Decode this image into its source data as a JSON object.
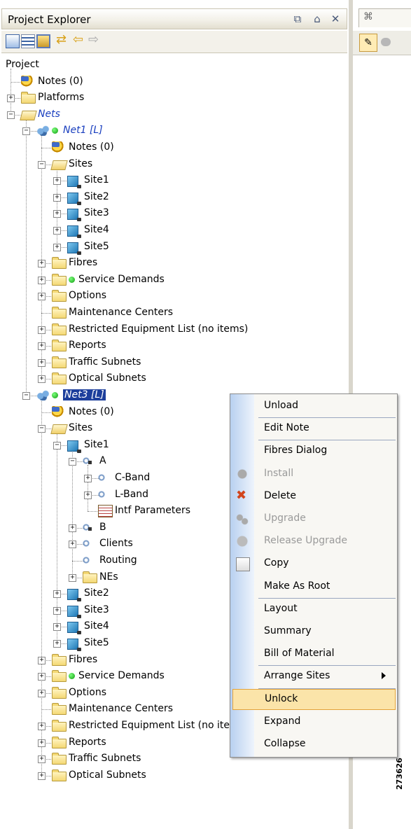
{
  "explorer": {
    "title": "Project Explorer",
    "window_buttons": [
      "⧉",
      "⌂",
      "✕"
    ]
  },
  "tree": [
    {
      "label": "Project",
      "icon": "none",
      "depth": 0,
      "expander": "none"
    },
    {
      "label": "Notes (0)",
      "icon": "notes",
      "depth": 1,
      "expander": "none"
    },
    {
      "label": "Platforms",
      "icon": "folder",
      "depth": 1,
      "expander": "+"
    },
    {
      "label": "Nets",
      "icon": "folder-open",
      "depth": 1,
      "expander": "-",
      "style": "italic-blue"
    },
    {
      "label": "Net1 [L]",
      "icon": "net",
      "depth": 2,
      "expander": "-",
      "style": "italic-blue",
      "status": "green"
    },
    {
      "label": "Notes (0)",
      "icon": "notes",
      "depth": 3,
      "expander": "none"
    },
    {
      "label": "Sites",
      "icon": "folder-open",
      "depth": 3,
      "expander": "-"
    },
    {
      "label": "Site1",
      "icon": "site",
      "depth": 4,
      "expander": "+"
    },
    {
      "label": "Site2",
      "icon": "site",
      "depth": 4,
      "expander": "+"
    },
    {
      "label": "Site3",
      "icon": "site",
      "depth": 4,
      "expander": "+"
    },
    {
      "label": "Site4",
      "icon": "site",
      "depth": 4,
      "expander": "+"
    },
    {
      "label": "Site5",
      "icon": "site",
      "depth": 4,
      "expander": "+"
    },
    {
      "label": "Fibres",
      "icon": "folder",
      "depth": 3,
      "expander": "+"
    },
    {
      "label": "Service Demands",
      "icon": "folder",
      "depth": 3,
      "expander": "+",
      "status": "green"
    },
    {
      "label": "Options",
      "icon": "folder",
      "depth": 3,
      "expander": "+"
    },
    {
      "label": "Maintenance Centers",
      "icon": "folder",
      "depth": 3,
      "expander": "none"
    },
    {
      "label": "Restricted Equipment List (no items)",
      "icon": "folder",
      "depth": 3,
      "expander": "+"
    },
    {
      "label": "Reports",
      "icon": "folder",
      "depth": 3,
      "expander": "+"
    },
    {
      "label": "Traffic Subnets",
      "icon": "folder",
      "depth": 3,
      "expander": "+"
    },
    {
      "label": "Optical Subnets",
      "icon": "folder",
      "depth": 3,
      "expander": "+"
    },
    {
      "label": "Net3 [L]",
      "icon": "net",
      "depth": 2,
      "expander": "-",
      "style": "selected",
      "status": "green"
    },
    {
      "label": "Notes (0)",
      "icon": "notes",
      "depth": 3,
      "expander": "none"
    },
    {
      "label": "Sites",
      "icon": "folder-open",
      "depth": 3,
      "expander": "-"
    },
    {
      "label": "Site1",
      "icon": "site",
      "depth": 4,
      "expander": "-"
    },
    {
      "label": "A",
      "icon": "ringlock",
      "depth": 5,
      "expander": "-"
    },
    {
      "label": "C-Band",
      "icon": "ring",
      "depth": 6,
      "expander": "+"
    },
    {
      "label": "L-Band",
      "icon": "ring",
      "depth": 6,
      "expander": "+"
    },
    {
      "label": "Intf Parameters",
      "icon": "grid",
      "depth": 6,
      "expander": "none"
    },
    {
      "label": "B",
      "icon": "ringlock",
      "depth": 5,
      "expander": "+"
    },
    {
      "label": "Clients",
      "icon": "ring",
      "depth": 5,
      "expander": "+"
    },
    {
      "label": "Routing",
      "icon": "ring",
      "depth": 5,
      "expander": "none"
    },
    {
      "label": "NEs",
      "icon": "folder",
      "depth": 5,
      "expander": "+"
    },
    {
      "label": "Site2",
      "icon": "site",
      "depth": 4,
      "expander": "+"
    },
    {
      "label": "Site3",
      "icon": "site",
      "depth": 4,
      "expander": "+"
    },
    {
      "label": "Site4",
      "icon": "site",
      "depth": 4,
      "expander": "+"
    },
    {
      "label": "Site5",
      "icon": "site",
      "depth": 4,
      "expander": "+"
    },
    {
      "label": "Fibres",
      "icon": "folder",
      "depth": 3,
      "expander": "+"
    },
    {
      "label": "Service Demands",
      "icon": "folder",
      "depth": 3,
      "expander": "+",
      "status": "green"
    },
    {
      "label": "Options",
      "icon": "folder",
      "depth": 3,
      "expander": "+"
    },
    {
      "label": "Maintenance Centers",
      "icon": "folder",
      "depth": 3,
      "expander": "none"
    },
    {
      "label": "Restricted Equipment List (no items)",
      "icon": "folder",
      "depth": 3,
      "expander": "+"
    },
    {
      "label": "Reports",
      "icon": "folder",
      "depth": 3,
      "expander": "+"
    },
    {
      "label": "Traffic Subnets",
      "icon": "folder",
      "depth": 3,
      "expander": "+"
    },
    {
      "label": "Optical Subnets",
      "icon": "folder",
      "depth": 3,
      "expander": "+"
    }
  ],
  "context_menu": {
    "items": [
      {
        "label": "Unload",
        "enabled": true,
        "icon": "none",
        "sep_after": true
      },
      {
        "label": "Edit Note",
        "enabled": true,
        "icon": "none",
        "sep_after": true
      },
      {
        "label": "Fibres Dialog",
        "enabled": true,
        "icon": "none",
        "sep_after": false
      },
      {
        "label": "Install",
        "enabled": false,
        "icon": "install-icon",
        "sep_after": false
      },
      {
        "label": "Delete",
        "enabled": true,
        "icon": "delete-icon",
        "sep_after": false
      },
      {
        "label": "Upgrade",
        "enabled": false,
        "icon": "upgrade-icon",
        "sep_after": false
      },
      {
        "label": "Release Upgrade",
        "enabled": false,
        "icon": "release-upgrade-icon",
        "sep_after": false
      },
      {
        "label": "Copy",
        "enabled": true,
        "icon": "copy-icon",
        "sep_after": false
      },
      {
        "label": "Make As Root",
        "enabled": true,
        "icon": "none",
        "sep_after": true
      },
      {
        "label": "Layout",
        "enabled": true,
        "icon": "none",
        "sep_after": false
      },
      {
        "label": "Summary",
        "enabled": true,
        "icon": "none",
        "sep_after": false
      },
      {
        "label": "Bill of Material",
        "enabled": true,
        "icon": "none",
        "sep_after": true
      },
      {
        "label": "Arrange Sites",
        "enabled": true,
        "icon": "none",
        "submenu": true,
        "sep_after": true
      },
      {
        "label": "Unlock",
        "enabled": true,
        "icon": "none",
        "hover": true,
        "sep_after": false
      },
      {
        "label": "Expand",
        "enabled": true,
        "icon": "none",
        "sep_after": false
      },
      {
        "label": "Collapse",
        "enabled": true,
        "icon": "none",
        "sep_after": false
      }
    ]
  },
  "right_panel": {
    "tab_icon": "network-icon",
    "pencil_icon": "pencil-icon",
    "figure_number": "273626"
  },
  "colors": {
    "selection": "#1d3f9c",
    "italic_link": "#1a3fbf",
    "menu_hover": "#fbe4a9",
    "status_green": "#0d9a0d"
  }
}
